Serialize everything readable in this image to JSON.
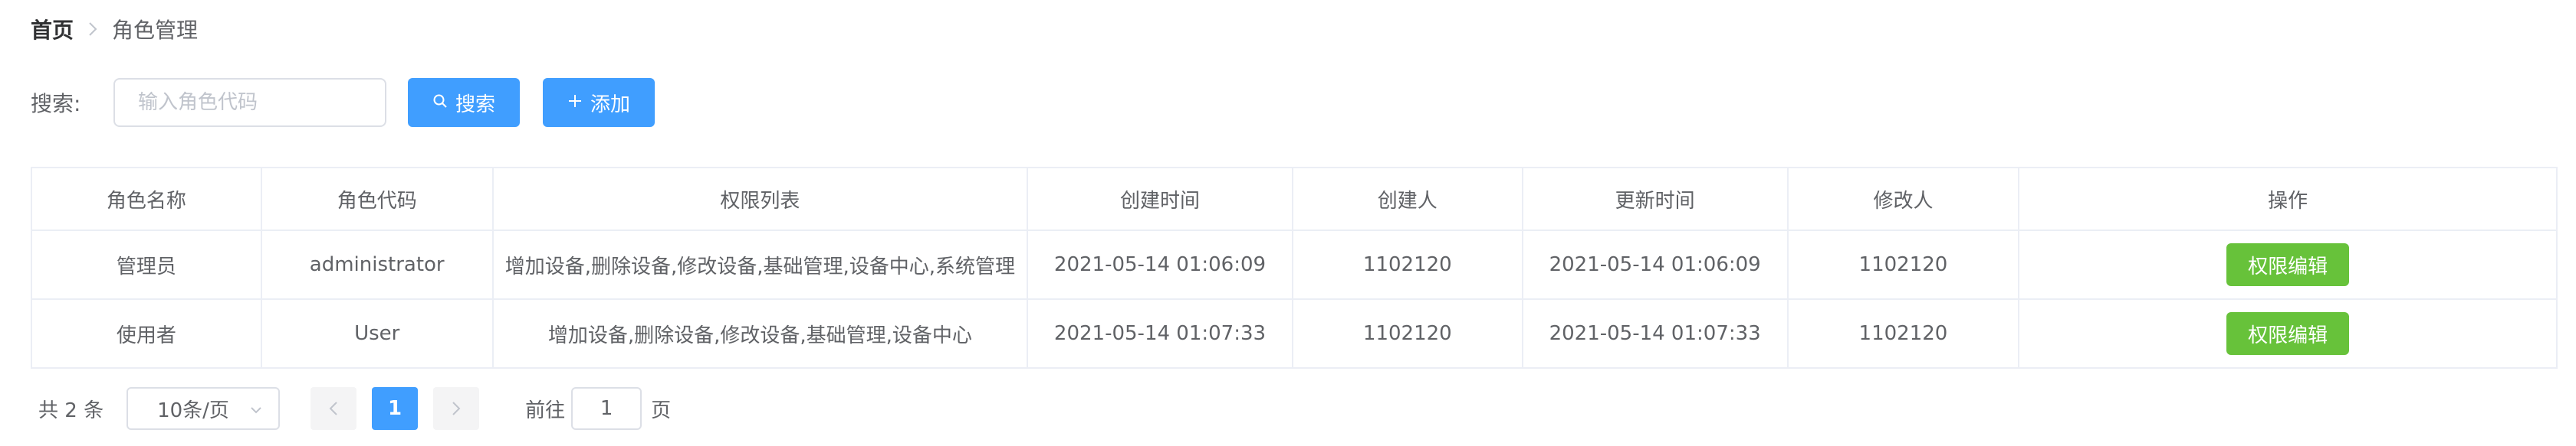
{
  "breadcrumb": {
    "home": "首页",
    "current": "角色管理"
  },
  "search": {
    "label": "搜索:",
    "placeholder": "输入角色代码",
    "value": "",
    "search_button": "搜索",
    "add_button": "添加"
  },
  "table": {
    "columns": [
      "角色名称",
      "角色代码",
      "权限列表",
      "创建时间",
      "创建人",
      "更新时间",
      "修改人",
      "操作"
    ],
    "rows": [
      {
        "name": "管理员",
        "code": "administrator",
        "permissions": "增加设备,删除设备,修改设备,基础管理,设备中心,系统管理",
        "created": "2021-05-14 01:06:09",
        "creator": "1102120",
        "updated": "2021-05-14 01:06:09",
        "modifier": "1102120",
        "action": "权限编辑"
      },
      {
        "name": "使用者",
        "code": "User",
        "permissions": "增加设备,删除设备,修改设备,基础管理,设备中心",
        "created": "2021-05-14 01:07:33",
        "creator": "1102120",
        "updated": "2021-05-14 01:07:33",
        "modifier": "1102120",
        "action": "权限编辑"
      }
    ]
  },
  "pagination": {
    "total": "共 2 条",
    "page_size": "10条/页",
    "current_page": "1",
    "goto_label": "前往",
    "goto_value": "1",
    "goto_suffix": "页"
  },
  "colors": {
    "primary": "#409eff",
    "success": "#67c23a",
    "border": "#ebeef5"
  }
}
